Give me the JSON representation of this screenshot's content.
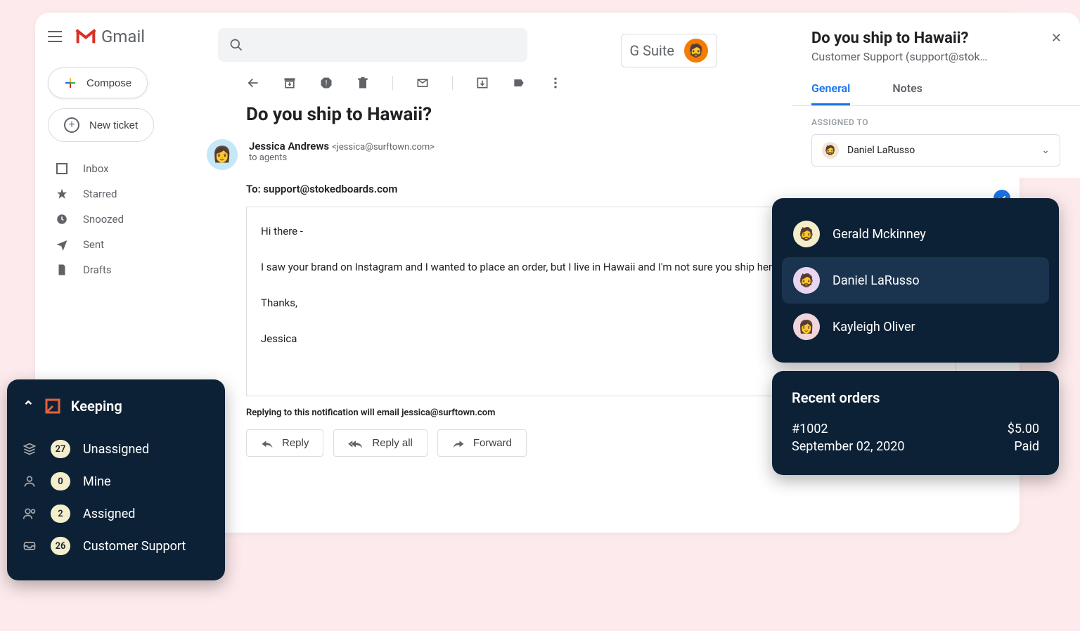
{
  "gmail": {
    "logo_text": "Gmail",
    "compose_label": "Compose",
    "new_ticket_label": "New ticket",
    "gsuite_label": "G Suite",
    "nav": [
      {
        "label": "Inbox",
        "icon": "inbox"
      },
      {
        "label": "Starred",
        "icon": "star"
      },
      {
        "label": "Snoozed",
        "icon": "clock"
      },
      {
        "label": "Sent",
        "icon": "send"
      },
      {
        "label": "Drafts",
        "icon": "file"
      }
    ]
  },
  "email": {
    "subject": "Do you ship to Hawaii?",
    "sender_name": "Jessica Andrews",
    "sender_email": "<jessica@surftown.com>",
    "to_agents": "to agents",
    "to_line": "To: support@stokedboards.com",
    "body_line1": "Hi there -",
    "body_line2": "I saw your brand on Instagram and I wanted to place an order, but I live in Hawaii and I'm not sure you ship here.",
    "body_line3": "Thanks,",
    "body_line4": "Jessica",
    "reply_note": "Replying to this notification will email jessica@surftown.com",
    "reply_label": "Reply",
    "reply_all_label": "Reply all",
    "forward_label": "Forward"
  },
  "keeping_panel": {
    "title": "Do you ship to Hawaii?",
    "subtitle": "Customer Support (support@stok…",
    "tab_general": "General",
    "tab_notes": "Notes",
    "assigned_label": "ASSIGNED TO",
    "assigned_value": "Daniel LaRusso"
  },
  "assignees": {
    "0": {
      "name": "Gerald Mckinney"
    },
    "1": {
      "name": "Daniel LaRusso"
    },
    "2": {
      "name": "Kayleigh Oliver"
    }
  },
  "orders": {
    "title": "Recent orders",
    "id": "#1002",
    "amount": "$5.00",
    "date": "September 02, 2020",
    "status": "Paid"
  },
  "keeping_sidebar": {
    "title": "Keeping",
    "items": {
      "0": {
        "label": "Unassigned",
        "count": "27"
      },
      "1": {
        "label": "Mine",
        "count": "0"
      },
      "2": {
        "label": "Assigned",
        "count": "2"
      },
      "3": {
        "label": "Customer Support",
        "count": "26"
      }
    }
  }
}
